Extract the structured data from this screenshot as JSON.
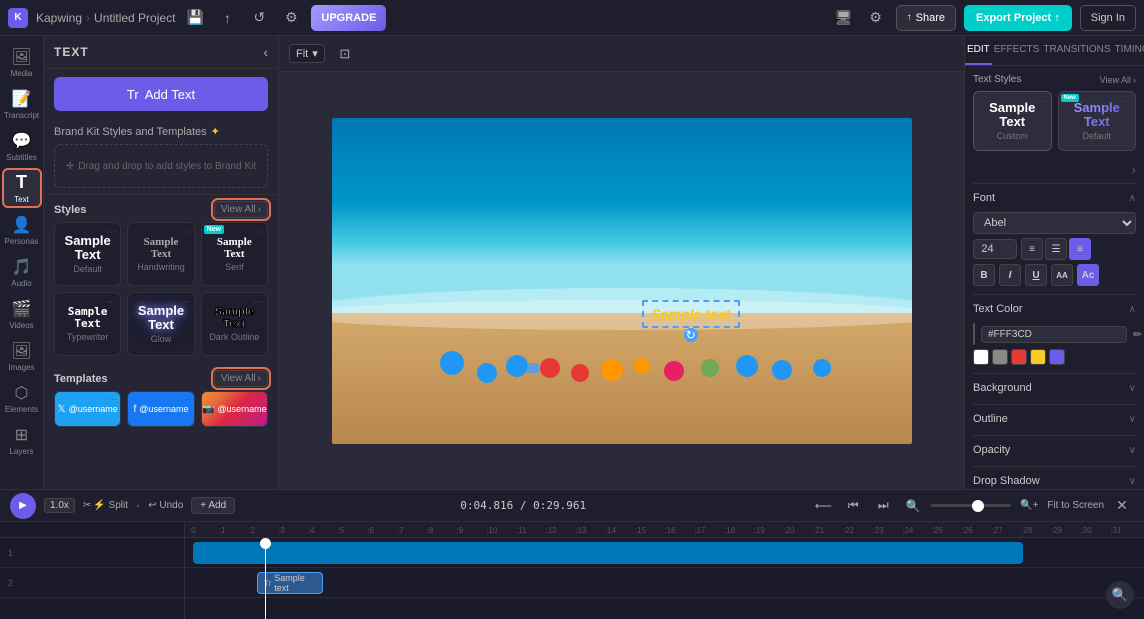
{
  "topbar": {
    "logo": "K",
    "brand": "Kapwing",
    "breadcrumb_sep": ">",
    "project": "Untitled Project",
    "upgrade_label": "UPGRADE",
    "share_label": "Share",
    "export_label": "Export Project",
    "signin_label": "Sign In"
  },
  "left_nav": {
    "items": [
      {
        "id": "media",
        "icon": "🖼",
        "label": "Media"
      },
      {
        "id": "transcript",
        "icon": "📝",
        "label": "Transcript"
      },
      {
        "id": "subtitles",
        "icon": "💬",
        "label": "Subtitles"
      },
      {
        "id": "text",
        "icon": "T",
        "label": "Text"
      },
      {
        "id": "personas",
        "icon": "👤",
        "label": "Personas"
      },
      {
        "id": "audio",
        "icon": "🎵",
        "label": "Audio"
      },
      {
        "id": "videos",
        "icon": "🎬",
        "label": "Videos"
      },
      {
        "id": "images",
        "icon": "🖼",
        "label": "Images"
      },
      {
        "id": "elements",
        "icon": "⬡",
        "label": "Elements"
      },
      {
        "id": "layers",
        "icon": "⊞",
        "label": "Layers"
      }
    ]
  },
  "text_panel": {
    "title": "TEXT",
    "add_text_label": "Tr  Add Text",
    "brand_kit_label": "Brand Kit Styles and Templates",
    "brand_kit_drop": "Drag and drop to add styles to Brand Kit",
    "styles_label": "Styles",
    "view_all_label": "View All",
    "styles": [
      {
        "label": "Default",
        "text": "Sample Text",
        "style": "default",
        "new": false
      },
      {
        "label": "Handwriting",
        "text": "Sample Text",
        "style": "handwriting",
        "new": false
      },
      {
        "label": "Serif",
        "text": "Sample Text",
        "style": "serif",
        "new": true
      },
      {
        "label": "Typewriter",
        "text": "Sample Text",
        "style": "typewriter",
        "new": false
      },
      {
        "label": "Glow",
        "text": "Sample Text",
        "style": "glow",
        "new": false
      },
      {
        "label": "Dark Outline",
        "text": "Sample Text",
        "style": "dark-outline",
        "new": false
      }
    ],
    "templates_label": "Templates",
    "templates": [
      {
        "label": "@username",
        "icon": "🔵"
      },
      {
        "label": "@username",
        "icon": "🔵"
      },
      {
        "label": "@username",
        "icon": "📷"
      }
    ]
  },
  "canvas": {
    "fit_label": "Fit",
    "sample_text": "Sample text"
  },
  "right_panel": {
    "tabs": [
      {
        "id": "edit",
        "label": "EDIT"
      },
      {
        "id": "effects",
        "label": "EFFECTS"
      },
      {
        "id": "transitions",
        "label": "TRANSITIONS"
      },
      {
        "id": "timing",
        "label": "TIMING"
      }
    ],
    "text_styles_label": "Text Styles",
    "view_all_label": "View All",
    "ts_cards": [
      {
        "label": "Custom",
        "text": "Sample\nText",
        "style": "default",
        "new": false
      },
      {
        "label": "Default",
        "text": "Sample\nText",
        "style": "colored",
        "new": true
      }
    ],
    "font_label": "Font",
    "font_name": "Abel",
    "font_size": "24",
    "text_color_label": "Text Color",
    "color_hex": "#FFF3CD",
    "background_label": "Background",
    "outline_label": "Outline",
    "opacity_label": "Opacity",
    "drop_shadow_label": "Drop Shadow"
  },
  "timeline": {
    "play_icon": "▶",
    "speed": "1.0x",
    "split_label": "⚡ Split",
    "undo_label": "↩ Undo",
    "time_current": "0:04.816",
    "time_total": "0:29.961",
    "fit_to_screen": "Fit to Screen",
    "ruler_marks": [
      ":0",
      ":1",
      ":2",
      ":3",
      ":4",
      ":5",
      ":6",
      ":7",
      ":8",
      ":9",
      ":10",
      ":11",
      ":12",
      ":13",
      ":14",
      ":15",
      ":16",
      ":17",
      ":18",
      ":19",
      ":20",
      ":21",
      ":22",
      ":23",
      ":24",
      ":25",
      ":26",
      ":27",
      ":28",
      ":29",
      ":30",
      ":31"
    ],
    "tracks": [
      {
        "row": "1",
        "clip": "video"
      },
      {
        "row": "2",
        "clip": "text",
        "label": "Sample text"
      }
    ]
  }
}
